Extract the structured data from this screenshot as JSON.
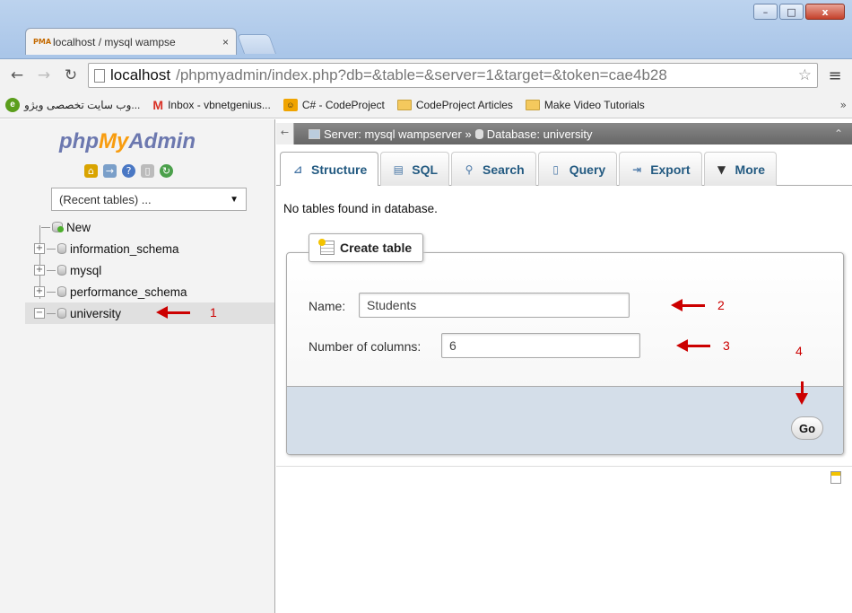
{
  "browser": {
    "tab_title": "localhost / mysql wampse",
    "tab_favicon": "PMA",
    "tab_close": "×",
    "url_host": "localhost",
    "url_path": "/phpmyadmin/index.php?db=&table=&server=1&target=&token=cae4b28",
    "bookmarks": [
      {
        "label": "وب سایت تخصصی ویژو...",
        "icon": "globe-icon"
      },
      {
        "label": "Inbox - vbnetgenius...",
        "icon": "gmail-icon"
      },
      {
        "label": "C# - CodeProject",
        "icon": "codeproject-icon"
      },
      {
        "label": "CodeProject Articles",
        "icon": "folder-icon"
      },
      {
        "label": "Make Video Tutorials",
        "icon": "folder-icon"
      }
    ],
    "bookmarks_more": "»"
  },
  "pma": {
    "logo": {
      "php": "php",
      "my": "My",
      "admin": "Admin"
    },
    "recent_tables": "(Recent tables) ...",
    "tree": [
      {
        "label": "New",
        "type": "new"
      },
      {
        "label": "information_schema",
        "type": "db"
      },
      {
        "label": "mysql",
        "type": "db"
      },
      {
        "label": "performance_schema",
        "type": "db"
      },
      {
        "label": "university",
        "type": "db",
        "selected": true
      }
    ],
    "breadcrumb": {
      "server": "Server: mysql wampserver »",
      "database": "Database: university"
    },
    "tabs": [
      {
        "label": "Structure",
        "icon": "structure-icon",
        "active": true
      },
      {
        "label": "SQL",
        "icon": "sql-icon"
      },
      {
        "label": "Search",
        "icon": "search-icon"
      },
      {
        "label": "Query",
        "icon": "query-icon"
      },
      {
        "label": "Export",
        "icon": "export-icon"
      },
      {
        "label": "More",
        "icon": "more-caret-icon"
      }
    ],
    "empty_message": "No tables found in database.",
    "create_table": {
      "legend": "Create table",
      "name_label": "Name:",
      "name_value": "Students",
      "columns_label": "Number of columns:",
      "columns_value": "6",
      "go_label": "Go"
    }
  },
  "annotations": {
    "a1": "1",
    "a2": "2",
    "a3": "3",
    "a4": "4",
    "color": "#cc0000"
  }
}
